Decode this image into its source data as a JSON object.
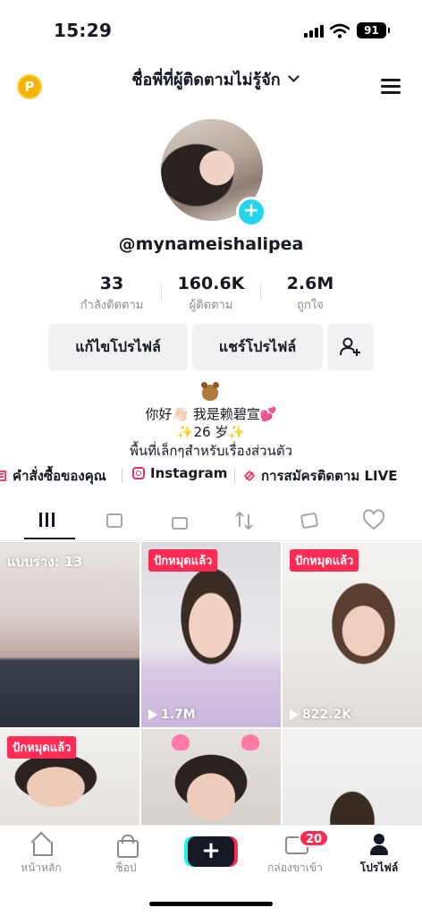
{
  "status_bar": {
    "time": "15:29",
    "battery": "91"
  },
  "header": {
    "coin_label": "P",
    "account_name": "ชื่อพี่ที่ผู้ติดตามไม่รู้จัก"
  },
  "profile": {
    "username": "@mynameishalipea",
    "stats": [
      {
        "value": "33",
        "label": "กำลังติดตาม"
      },
      {
        "value": "160.6K",
        "label": "ผู้ติดตาม"
      },
      {
        "value": "2.6M",
        "label": "ถูกใจ"
      }
    ],
    "buttons": {
      "edit": "แก้ไขโปรไฟล์",
      "share": "แชร์โปรไฟล์"
    },
    "bio": [
      "你好👋🏻 我是赖碧宣💕",
      "✨26 岁✨",
      "พื้นที่เล็กๆสำหรับเรื่องส่วนตัว"
    ]
  },
  "links": [
    {
      "label": "คำสั่งซื้อของคุณ",
      "icon": "order-icon"
    },
    {
      "label": "Instagram",
      "icon": "instagram-icon"
    },
    {
      "label": "การสมัครติดตาม LIVE",
      "icon": "live-subscription-icon"
    }
  ],
  "tabs": [
    "videos-grid-icon",
    "shop-bag-icon",
    "private-lock-icon",
    "reposts-icon",
    "favorites-icon",
    "liked-icon"
  ],
  "videos": [
    {
      "draft_label": "แบบร่าง: 13"
    },
    {
      "badge": "ปักหมุดแล้ว",
      "views": "1.7M"
    },
    {
      "badge": "ปักหมุดแล้ว",
      "views": "822.2K"
    },
    {
      "badge": "ปักหมุดแล้ว"
    },
    {},
    {}
  ],
  "bottom_nav": {
    "home": "หน้าหลัก",
    "shop": "ช็อป",
    "create": "+",
    "inbox": "กล่องขาเข้า",
    "inbox_badge": "20",
    "profile": "โปรไฟล์"
  },
  "colors": {
    "accent": "#fe2c55",
    "cyan": "#20d5ec",
    "coin": "#f5b301"
  }
}
